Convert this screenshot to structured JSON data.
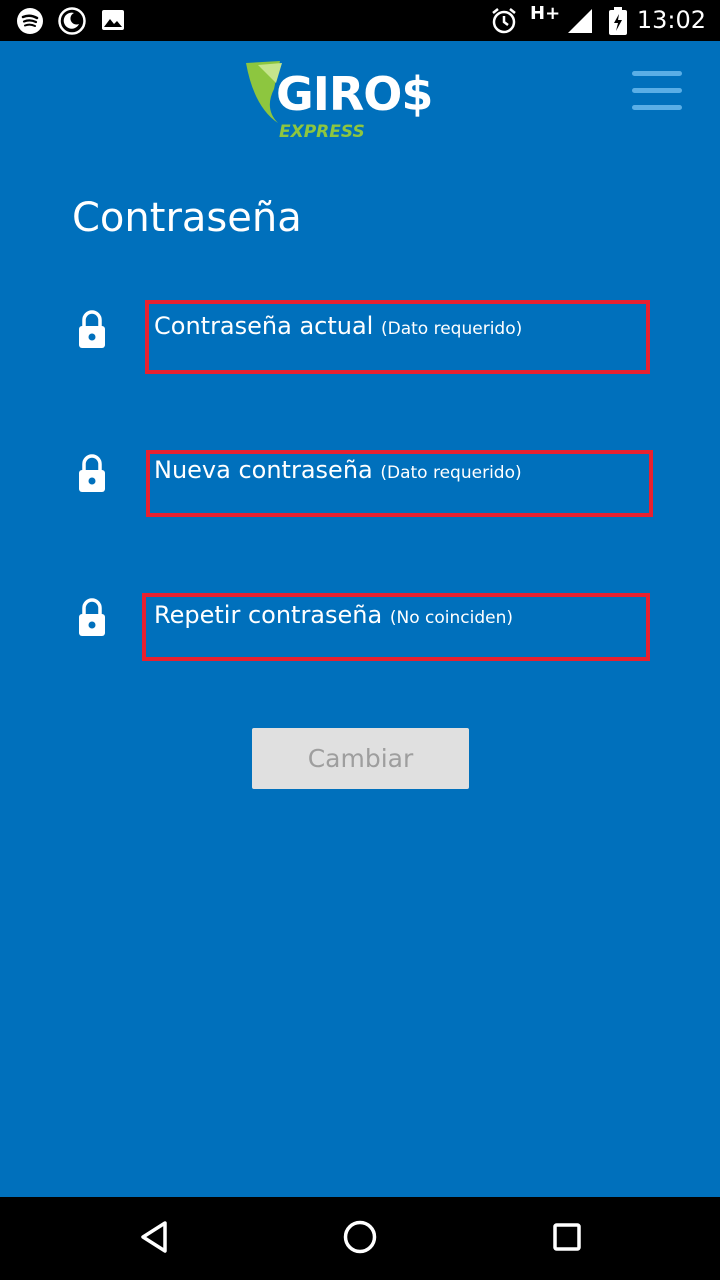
{
  "status_bar": {
    "time": "13:02",
    "network": "H+",
    "icons": [
      "spotify-icon",
      "night-mode-icon",
      "image-icon",
      "alarm-icon",
      "signal-icon",
      "battery-icon"
    ]
  },
  "header": {
    "logo_main": "GIRO$",
    "logo_sub": "EXPRESS",
    "menu_icon": "hamburger-menu-icon"
  },
  "page": {
    "title": "Contraseña"
  },
  "fields": [
    {
      "label": "Contraseña actual",
      "hint": "(Dato requerido)",
      "icon": "lock-icon"
    },
    {
      "label": "Nueva contraseña",
      "hint": "(Dato requerido)",
      "icon": "lock-icon"
    },
    {
      "label": "Repetir contraseña",
      "hint": "(No coinciden)",
      "icon": "lock-icon"
    }
  ],
  "actions": {
    "change_label": "Cambiar"
  },
  "colors": {
    "background": "#0070bc",
    "error_border": "#e8202f",
    "logo_green": "#8dc63f",
    "button_disabled_bg": "#e0e0e0",
    "button_disabled_text": "#9e9e9e"
  },
  "nav_bar": {
    "icons": [
      "back-icon",
      "home-icon",
      "recents-icon"
    ]
  }
}
